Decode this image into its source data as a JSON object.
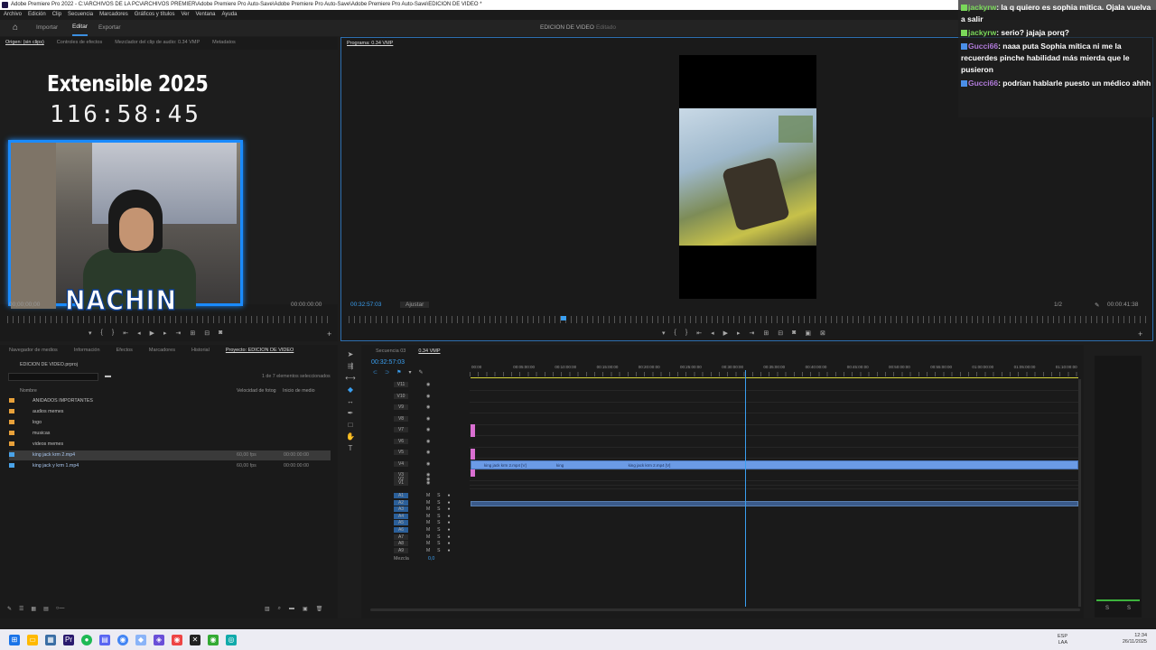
{
  "titlebar": {
    "text": "Adobe Premiere Pro 2022 - C:\\ARCHIVOS DE LA PC\\ARCHIVOS PREMIER\\Adobe Premiere Pro Auto-Save\\Adobe Premiere Pro Auto-Save\\Adobe Premiere Pro Auto-Save\\EDICION DE VIDEO *"
  },
  "menu": [
    "Archivo",
    "Edición",
    "Clip",
    "Secuencia",
    "Marcadores",
    "Gráficos y títulos",
    "Ver",
    "Ventana",
    "Ayuda"
  ],
  "workspace": {
    "tabs": [
      "Importar",
      "Editar",
      "Exportar"
    ],
    "active": "Editar",
    "center_title": "EDICION DE VIDEO",
    "center_status": "- Editado"
  },
  "source": {
    "tabs": [
      "Origen: (sin clips)",
      "Controles de efectos",
      "Mezclador del clip de audio: 0.34 VMP",
      "Metadatos"
    ],
    "overlay_title": "Extensible 2025",
    "overlay_timer": "116:58:45",
    "cam_label": "NACHIN",
    "timecode_left": "00;00;00;00",
    "timecode_right": "00:00:00:00"
  },
  "program": {
    "tab": "Programa: 0.34 VMP",
    "timecode": "00:32:57:03",
    "fit": "Ajustar",
    "ratio": "1/2",
    "duration": "00:00:41:38"
  },
  "chat": [
    {
      "user": "jackyrw",
      "text": ": la q quiero es sophia mitica. Ojala vuelva a salir"
    },
    {
      "user": "jackyrw",
      "text": ": serio? jajaja porq?"
    },
    {
      "user": "Gucci66",
      "text": ": naaa puta Sophia mítica ni me la recuerdes pinche habilidad más mierda que le pusieron"
    },
    {
      "user": "Gucci66",
      "text": ": podrían hablarle puesto un médico ahhh"
    }
  ],
  "project": {
    "tabs": [
      "Navegador de medios",
      "Información",
      "Efectos",
      "Marcadores",
      "Historial",
      "Proyecto: EDICION DE VIDEO"
    ],
    "file": "EDICION DE VIDEO.prproj",
    "selection": "1 de 7 elementos seleccionados",
    "columns": [
      "Nombre",
      "Velocidad de fotog",
      "Inicio de medio"
    ],
    "items": [
      {
        "name": "ANIDADOS IMPORTANTES",
        "type": "folder",
        "fps": "",
        "start": ""
      },
      {
        "name": "audios memes",
        "type": "folder",
        "fps": "",
        "start": ""
      },
      {
        "name": "logo",
        "type": "folder",
        "fps": "",
        "start": ""
      },
      {
        "name": "musicas",
        "type": "folder",
        "fps": "",
        "start": ""
      },
      {
        "name": "videos memes",
        "type": "folder",
        "fps": "",
        "start": ""
      },
      {
        "name": "king jack krm 2.mp4",
        "type": "clip",
        "fps": "60,00 fps",
        "start": "00:00:00:00"
      },
      {
        "name": "king jack y krm 1.mp4",
        "type": "clip",
        "fps": "60,00 fps",
        "start": "00:00:00:00"
      }
    ]
  },
  "timeline": {
    "tabs": [
      "Secuencia 03",
      "0.34 VMP"
    ],
    "timecode": "00:32:57:03",
    "ruler": [
      "00:00",
      "00:05:00:00",
      "00:10:00:00",
      "00:15:00:00",
      "00:20:00:00",
      "00:25:00:00",
      "00:30:00:00",
      "00:35:00:00",
      "00:40:00:00",
      "00:45:00:00",
      "00:50:00:00",
      "00:55:00:00",
      "01:00:00:00",
      "01:05:00:00",
      "01:10:00:00"
    ],
    "video_tracks": [
      "V11",
      "V10",
      "V9",
      "V8",
      "V7",
      "V6",
      "V5",
      "V4",
      "V3",
      "V2",
      "V1"
    ],
    "audio_tracks": [
      "A1",
      "A2",
      "A3",
      "A4",
      "A5",
      "A6",
      "A7",
      "A8",
      "A9"
    ],
    "clip_label_1": "king jack krm 2.mp4 [V]",
    "clip_label_2": "king",
    "clip_label_3": "king jack krm 2.mp4 [V]",
    "mix_label": "Mezcla",
    "mix_value": "0,0"
  },
  "taskbar": {
    "lang": "ESP\nLAA",
    "time": "12:34",
    "date": "26/11/2025"
  }
}
